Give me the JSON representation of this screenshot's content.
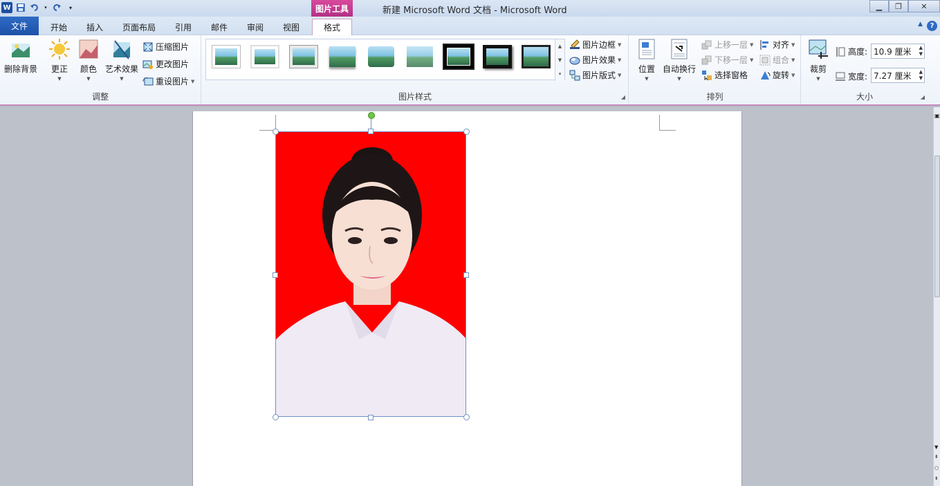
{
  "title_bar": {
    "title": "新建 Microsoft Word 文档 - Microsoft Word",
    "contextual_tab_group": "图片工具",
    "app_logo": "W"
  },
  "tabs": [
    {
      "label": "文件"
    },
    {
      "label": "开始"
    },
    {
      "label": "插入"
    },
    {
      "label": "页面布局"
    },
    {
      "label": "引用"
    },
    {
      "label": "邮件"
    },
    {
      "label": "审阅"
    },
    {
      "label": "视图"
    },
    {
      "label": "格式"
    }
  ],
  "ribbon": {
    "adjust": {
      "label": "调整",
      "remove_background": "删除背景",
      "corrections": "更正",
      "color": "颜色",
      "artistic_effects": "艺术效果",
      "compress": "压缩图片",
      "change_picture": "更改图片",
      "reset_picture": "重设图片"
    },
    "picture_styles": {
      "label": "图片样式",
      "border": "图片边框",
      "effects": "图片效果",
      "layout": "图片版式"
    },
    "arrange": {
      "label": "排列",
      "position": "位置",
      "wrap_text": "自动换行",
      "bring_forward": "上移一层",
      "send_backward": "下移一层",
      "selection_pane": "选择窗格",
      "align": "对齐",
      "group": "组合",
      "rotate": "旋转"
    },
    "size": {
      "label": "大小",
      "crop": "裁剪",
      "height_label": "高度:",
      "height_value": "10.9 厘米",
      "width_label": "宽度:",
      "width_value": "7.27 厘米"
    }
  },
  "colors": {
    "photo_background": "#ff0000",
    "file_tab": "#2f6bc4",
    "contextual_tab": "#c13a92"
  }
}
